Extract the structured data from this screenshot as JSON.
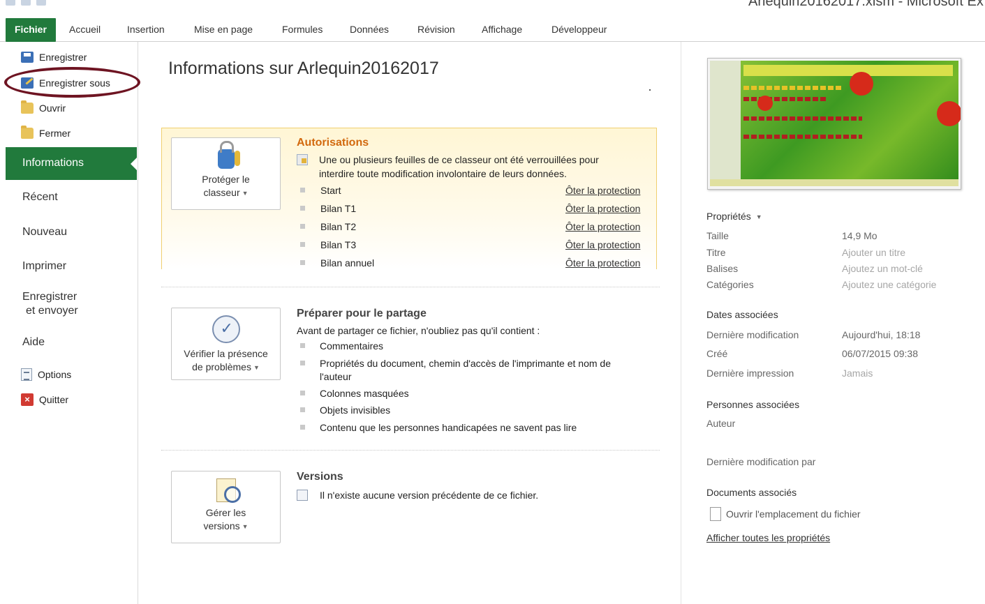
{
  "window": {
    "title": "Arlequin20162017.xlsm - Microsoft Ex"
  },
  "ribbon": {
    "file_tab": "Fichier",
    "tabs": [
      "Accueil",
      "Insertion",
      "Mise en page",
      "Formules",
      "Données",
      "Révision",
      "Affichage",
      "Développeur"
    ]
  },
  "nav": {
    "save": "Enregistrer",
    "save_as": "Enregistrer sous",
    "open": "Ouvrir",
    "close": "Fermer",
    "info": "Informations",
    "recent": "Récent",
    "new": "Nouveau",
    "print": "Imprimer",
    "save_send_1": "Enregistrer",
    "save_send_2": "et envoyer",
    "help": "Aide",
    "options": "Options",
    "quit": "Quitter"
  },
  "main": {
    "title": "Informations sur Arlequin20162017",
    "permissions": {
      "button_line1": "Protéger le",
      "button_line2": "classeur",
      "title": "Autorisations",
      "desc_line1": "Une ou plusieurs feuilles de ce classeur ont été verrouillées pour",
      "desc_line2": "interdire toute modification involontaire de leurs données.",
      "sheets": [
        "Start",
        "Bilan T1",
        "Bilan T2",
        "Bilan T3",
        "Bilan annuel"
      ],
      "unprotect_label": "Ôter la protection"
    },
    "prepare": {
      "button_line1": "Vérifier la présence",
      "button_line2": "de problèmes",
      "title": "Préparer pour le partage",
      "desc": "Avant de partager ce fichier, n'oubliez pas qu'il contient :",
      "items": [
        "Commentaires",
        "Propriétés du document, chemin d'accès de l'imprimante et nom de",
        "l'auteur",
        "Colonnes masquées",
        "Objets invisibles",
        "Contenu que les personnes handicapées ne savent pas lire"
      ]
    },
    "versions": {
      "button_line1": "Gérer les",
      "button_line2": "versions",
      "title": "Versions",
      "desc": "Il n'existe aucune version précédente de ce fichier."
    }
  },
  "properties": {
    "header": "Propriétés",
    "size_label": "Taille",
    "size_value": "14,9 Mo",
    "title_label": "Titre",
    "title_value": "Ajouter un titre",
    "tags_label": "Balises",
    "tags_value": "Ajoutez un mot-clé",
    "categories_label": "Catégories",
    "categories_value": "Ajoutez une catégorie",
    "dates_header": "Dates associées",
    "modified_label": "Dernière modification",
    "modified_value": "Aujourd'hui, 18:18",
    "created_label": "Créé",
    "created_value": "06/07/2015 09:38",
    "printed_label": "Dernière impression",
    "printed_value": "Jamais",
    "people_header": "Personnes associées",
    "author_label": "Auteur",
    "modified_by_label": "Dernière modification par",
    "docs_header": "Documents associés",
    "open_location": "Ouvrir l'emplacement du fichier",
    "show_all": "Afficher toutes les propriétés"
  },
  "colors": {
    "accent_green": "#217a3c",
    "oval_annotation": "#6e1422",
    "warning_title": "#d2690e"
  }
}
